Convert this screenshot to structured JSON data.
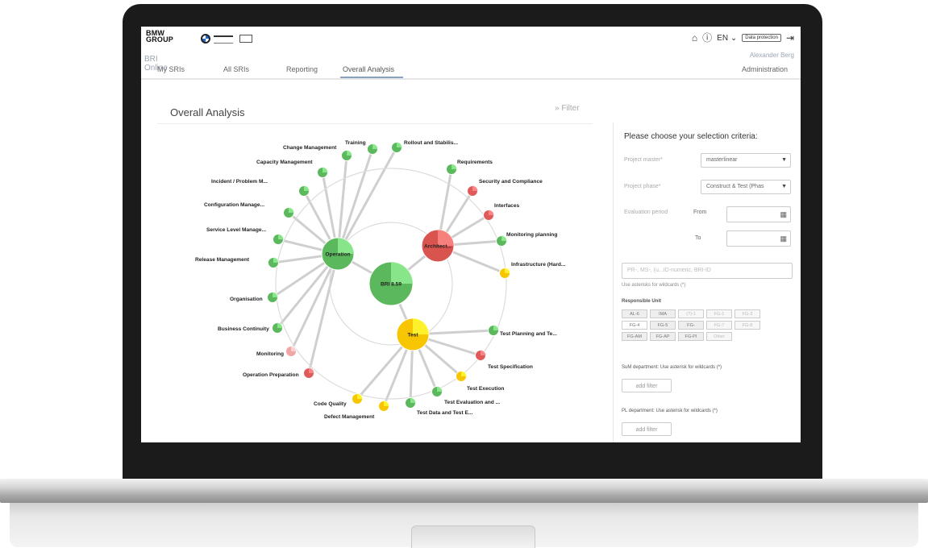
{
  "brand": {
    "group_logo": "BMW\nGROUP",
    "app_name": "BRI Online"
  },
  "header": {
    "language": "EN",
    "data_protection": "Data protection",
    "user_name": "Alexander Berg"
  },
  "nav": {
    "tabs": [
      {
        "label": "My SRIs"
      },
      {
        "label": "All SRIs"
      },
      {
        "label": "Reporting"
      },
      {
        "label": "Overall Analysis"
      }
    ],
    "active_tab": "Overall Analysis",
    "administration": "Administration"
  },
  "content": {
    "title": "Overall Analysis",
    "filter_toggle": "Filter"
  },
  "graph": {
    "center": {
      "label": "BRI 8.59",
      "color": "#5cb85c"
    },
    "hubs": [
      {
        "id": "operation",
        "label": "Operation",
        "color": "#5cb85c"
      },
      {
        "id": "architecture",
        "label": "Architect...",
        "color": "#d9534f"
      },
      {
        "id": "test",
        "label": "Test",
        "color": "#f7c600"
      }
    ],
    "leaves": [
      {
        "label": "Training",
        "status": "green",
        "hub": "operation"
      },
      {
        "label": "Change Management",
        "status": "green",
        "hub": "operation"
      },
      {
        "label": "Capacity Management",
        "status": "green",
        "hub": "operation"
      },
      {
        "label": "Incident / Problem M...",
        "status": "green",
        "hub": "operation"
      },
      {
        "label": "Configuration Manage...",
        "status": "green",
        "hub": "operation"
      },
      {
        "label": "Service Level Manage...",
        "status": "green",
        "hub": "operation"
      },
      {
        "label": "Release Management",
        "status": "green",
        "hub": "operation"
      },
      {
        "label": "Organisation",
        "status": "green",
        "hub": "operation"
      },
      {
        "label": "Business Continuity",
        "status": "green",
        "hub": "operation"
      },
      {
        "label": "Monitoring",
        "status": "pink",
        "hub": "operation"
      },
      {
        "label": "Operation Preparation",
        "status": "red",
        "hub": "operation"
      },
      {
        "label": "Rollout and Stabilis...",
        "status": "green",
        "hub": "operation"
      },
      {
        "label": "Requirements",
        "status": "green",
        "hub": "architecture"
      },
      {
        "label": "Security and Compliance",
        "status": "red",
        "hub": "architecture"
      },
      {
        "label": "Interfaces",
        "status": "red",
        "hub": "architecture"
      },
      {
        "label": "Monitoring planning",
        "status": "green",
        "hub": "architecture"
      },
      {
        "label": "Infrastructure (Hard...",
        "status": "yellow",
        "hub": "architecture"
      },
      {
        "label": "Test Planning and Te...",
        "status": "green",
        "hub": "test"
      },
      {
        "label": "Test Specification",
        "status": "red",
        "hub": "test"
      },
      {
        "label": "Test Execution",
        "status": "yellow",
        "hub": "test"
      },
      {
        "label": "Test Evaluation and ...",
        "status": "green",
        "hub": "test"
      },
      {
        "label": "Test Data and Test E...",
        "status": "green",
        "hub": "test"
      },
      {
        "label": "Defect Management",
        "status": "yellow",
        "hub": "test"
      },
      {
        "label": "Code Quality",
        "status": "yellow",
        "hub": "test"
      }
    ],
    "status_colors": {
      "green": "#5cb85c",
      "red": "#e05a5a",
      "pink": "#f2a5a5",
      "yellow": "#f7c600"
    }
  },
  "filter_panel": {
    "title": "Please choose your selection criteria:",
    "project_master_label": "Project master*",
    "project_master_value": "masterlinear",
    "project_phase_label": "Project phase*",
    "project_phase_value": "Construct & Test (Phas",
    "evaluation_period_label": "Evaluation period",
    "from_label": "From",
    "to_label": "To",
    "search_placeholder": "PR-, MS-, (u...ID-numeric, BRI-ID",
    "search_hint": "Use asterisks for wildcards (*)",
    "responsible_unit_label": "Responsible Unit",
    "units": [
      [
        {
          "label": "AL-6",
          "style": "grey"
        },
        {
          "label": "IMA",
          "style": "grey"
        },
        {
          "label": "(?)-1",
          "style": "dim"
        },
        {
          "label": "FG-1",
          "style": "dim"
        },
        {
          "label": "FG-3",
          "style": "dim"
        }
      ],
      [
        {
          "label": "FG-4",
          "style": "white"
        },
        {
          "label": "FG-5",
          "style": "grey"
        },
        {
          "label": "FG-",
          "style": "grey"
        },
        {
          "label": "FG-7",
          "style": "dim"
        },
        {
          "label": "FG-8",
          "style": "dim"
        }
      ],
      [
        {
          "label": "FG-AM",
          "style": "grey"
        },
        {
          "label": "FG-AP",
          "style": "grey"
        },
        {
          "label": "FG-PI",
          "style": "grey"
        },
        {
          "label": "Other",
          "style": "dim"
        }
      ]
    ],
    "sum_department_label": "SuM department: Use asterisk for wildcards (*)",
    "pl_department_label": "PL department: Use asterisk for wildcards (*)",
    "add_filter_label": "add filter"
  }
}
